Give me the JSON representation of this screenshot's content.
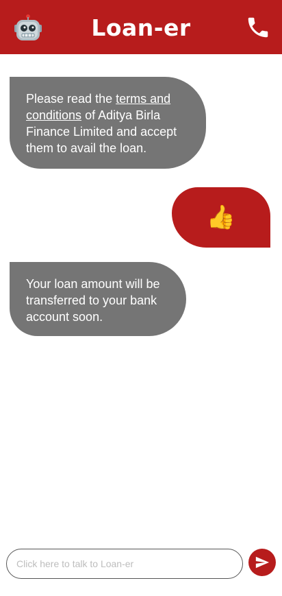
{
  "header": {
    "title": "Loan-er",
    "avatar_icon": "robot-face-icon",
    "call_icon": "phone-icon"
  },
  "messages": [
    {
      "sender": "bot",
      "text_before": "Please read the ",
      "link_text": "terms and conditions",
      "text_after": " of Aditya Birla Finance Limited and accept them to avail the loan."
    },
    {
      "sender": "user",
      "emoji": "👍",
      "icon": "thumbs-up-icon"
    },
    {
      "sender": "bot",
      "text": "Your loan amount will be transferred to your bank account soon."
    }
  ],
  "composer": {
    "placeholder": "Click here to talk to Loan-er",
    "value": "",
    "send_icon": "send-icon"
  },
  "colors": {
    "brand": "#b71c1c",
    "bot_bubble": "#757575",
    "background": "#ffffff"
  }
}
